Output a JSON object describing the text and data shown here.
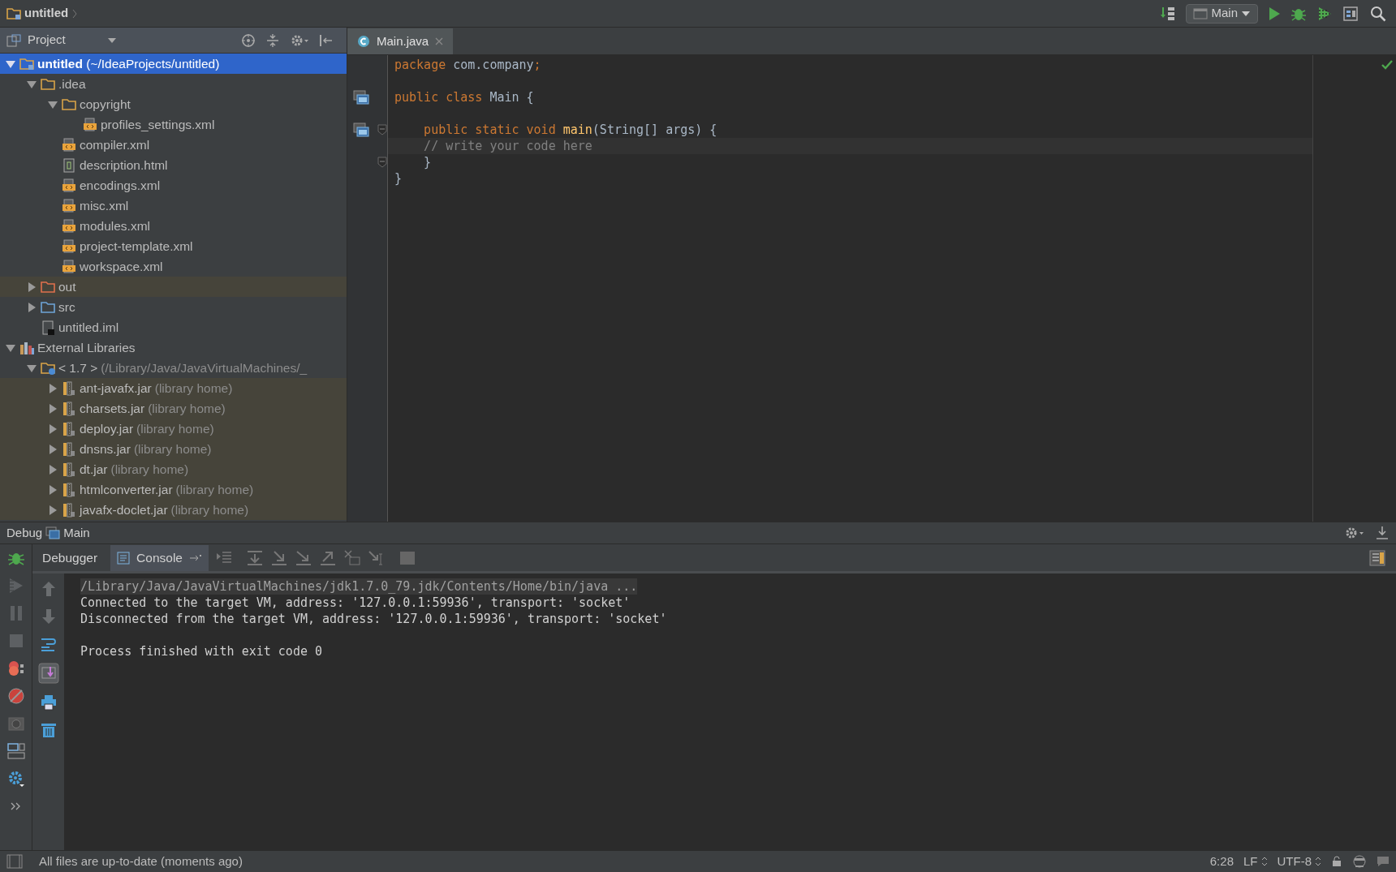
{
  "title_bar": {
    "project": "untitled"
  },
  "run_config": {
    "label": "Main"
  },
  "project_panel": {
    "title": "Project",
    "tree": [
      {
        "label": "**untitled** (~/IdeaProjects/untitled)",
        "kind": "project",
        "expanded": true,
        "selected": true,
        "children": [
          {
            "label": ".idea",
            "kind": "folder",
            "expanded": true,
            "selected": false,
            "children": [
              {
                "label": "copyright",
                "kind": "folder",
                "expanded": true,
                "selected": false,
                "children": [
                  {
                    "label": "profiles_settings.xml",
                    "kind": "xml",
                    "selected": false
                  }
                ]
              },
              {
                "label": "compiler.xml",
                "kind": "xml",
                "selected": false
              },
              {
                "label": "description.html",
                "kind": "html",
                "selected": false
              },
              {
                "label": "encodings.xml",
                "kind": "xml",
                "selected": false
              },
              {
                "label": "misc.xml",
                "kind": "xml",
                "selected": false
              },
              {
                "label": "modules.xml",
                "kind": "xml",
                "selected": false
              },
              {
                "label": "project-template.xml",
                "kind": "xml",
                "selected": false
              },
              {
                "label": "workspace.xml",
                "kind": "xml",
                "selected": false
              }
            ]
          },
          {
            "label": "out",
            "kind": "excluded-folder",
            "expanded": false,
            "selected": false
          },
          {
            "label": "src",
            "kind": "source-folder",
            "expanded": false,
            "selected": false
          },
          {
            "label": "untitled.iml",
            "kind": "module-file",
            "selected": false
          }
        ]
      },
      {
        "label": "External Libraries",
        "kind": "libraries",
        "expanded": true,
        "selected": false,
        "children": [
          {
            "label": "< 1.7 >",
            "note": "(/Library/Java/JavaVirtualMachines/_",
            "kind": "jdk",
            "expanded": true,
            "selected": false,
            "children": [
              {
                "label": "ant-javafx.jar",
                "note": "(library home)",
                "kind": "jar",
                "expanded": false,
                "selected": false
              },
              {
                "label": "charsets.jar",
                "note": "(library home)",
                "kind": "jar",
                "expanded": false,
                "selected": false
              },
              {
                "label": "deploy.jar",
                "note": "(library home)",
                "kind": "jar",
                "expanded": false,
                "selected": false
              },
              {
                "label": "dnsns.jar",
                "note": "(library home)",
                "kind": "jar",
                "expanded": false,
                "selected": false
              },
              {
                "label": "dt.jar",
                "note": "(library home)",
                "kind": "jar",
                "expanded": false,
                "selected": false
              },
              {
                "label": "htmlconverter.jar",
                "note": "(library home)",
                "kind": "jar",
                "expanded": false,
                "selected": false
              },
              {
                "label": "javafx-doclet.jar",
                "note": "(library home)",
                "kind": "jar",
                "expanded": false,
                "selected": false
              }
            ]
          }
        ]
      }
    ]
  },
  "editor": {
    "tabs": [
      {
        "label": "Main.java",
        "selected": true
      }
    ],
    "lines": [
      {
        "tokens": [
          {
            "text": "package",
            "kind": "keyword"
          },
          {
            "text": " com.company",
            "kind": "plain"
          },
          {
            "text": ";",
            "kind": "keyword"
          }
        ]
      },
      {
        "blank_line_before": true,
        "marker": true,
        "tokens": [
          {
            "text": "public class",
            "kind": "keyword"
          },
          {
            "text": " Main {",
            "kind": "plain"
          }
        ]
      },
      {
        "blank_line_before": true,
        "marker": true,
        "fold": true,
        "tokens": [
          {
            "text": "    public static void ",
            "kind": "keyword"
          },
          {
            "text": "main",
            "kind": "method"
          },
          {
            "text": "(String[] args) {",
            "kind": "plain"
          }
        ]
      },
      {
        "current": true,
        "tokens": [
          {
            "text": "    // write your code here",
            "kind": "comment"
          }
        ]
      },
      {
        "fold": true,
        "tokens": [
          {
            "text": "    }",
            "kind": "plain"
          }
        ]
      },
      {
        "tokens": [
          {
            "text": "}",
            "kind": "plain"
          }
        ]
      }
    ]
  },
  "debug": {
    "title": "Debug",
    "config": "Main",
    "tabs": [
      {
        "label": "Debugger",
        "selected": false
      },
      {
        "label": "Console",
        "selected": true
      }
    ],
    "console": [
      {
        "text": "/Library/Java/JavaVirtualMachines/jdk1.7.0_79.jdk/Contents/Home/bin/java ...",
        "kind": "command"
      },
      {
        "text": "Connected to the target VM, address: '127.0.0.1:59936', transport: 'socket'",
        "kind": "output"
      },
      {
        "text": "Disconnected from the target VM, address: '127.0.0.1:59936', transport: 'socket'",
        "kind": "output"
      },
      {
        "text": "Process finished with exit code 0",
        "kind": "exit"
      }
    ]
  },
  "status_bar": {
    "message": "All files are up-to-date (moments ago)",
    "position": "6:28",
    "line_separator": "LF",
    "encoding": "UTF-8"
  }
}
